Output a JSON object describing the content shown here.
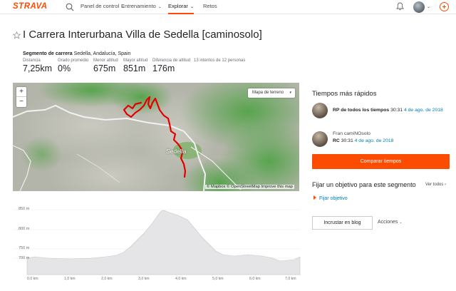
{
  "nav": {
    "logo": "STRAVA",
    "items": [
      {
        "label": "Panel de control",
        "caret": "⌄"
      },
      {
        "label": "Entrenamiento",
        "caret": "⌄"
      },
      {
        "label": "Explorar",
        "caret": "⌄",
        "active": true
      },
      {
        "label": "Retos"
      }
    ],
    "avatar_caret": "⌄"
  },
  "segment": {
    "title": "I Carrera Interurbana Villa de Sedella [caminosolo]",
    "type_label": "Segmento de carrera",
    "location": "Sedella, Andalucía, Spain",
    "stats": [
      {
        "label": "Distancia",
        "value": "7,25km"
      },
      {
        "label": "Grado promedio",
        "value": "0%"
      },
      {
        "label": "Menor altitud",
        "value": "675m"
      },
      {
        "label": "Mayor altitud",
        "value": "851m"
      },
      {
        "label": "Diferencia de altitud",
        "value": "176m"
      }
    ],
    "attempts": "13 intentos de 12 personas"
  },
  "map": {
    "zoom_in": "+",
    "zoom_out": "−",
    "map_type": "Mapa de terreno",
    "map_type_caret": "▾",
    "town": "Sedella",
    "attribution": "© Mapbox © OpenStreetMap Improve this map",
    "route_color": "#e30000"
  },
  "leaderboard": {
    "title": "Tiempos más rápidos",
    "entries": [
      {
        "name": "",
        "badge": "RP de todos los tiempos",
        "time": "30:31",
        "date": "4 de ago. de 2018"
      },
      {
        "name": "Fran camiNOsolo",
        "badge": "RC",
        "time": "30:31",
        "date": "4 de ago. de 2018"
      }
    ],
    "compare_button": "Comparar tiempos"
  },
  "goal": {
    "title": "Fijar un objetivo para este segmento",
    "see_all": "Ver todos",
    "see_all_caret": "›",
    "link": "Fijar objetivo"
  },
  "actions": {
    "blog_button": "Incrustar en blog",
    "actions_label": "Acciones",
    "actions_caret": "⌄"
  },
  "elevation": {
    "y_labels": [
      "850 m",
      "800 m",
      "750 m",
      "700 m"
    ],
    "x_labels": [
      "0,0 km",
      "1,0 km",
      "2,0 km",
      "3,0 km",
      "4,0 km",
      "5,0 km",
      "6,0 km",
      "7,0 km"
    ]
  },
  "colors": {
    "brand": "#fc4c02",
    "link": "#007fb6",
    "profile_fill": "#e5e5e7"
  }
}
